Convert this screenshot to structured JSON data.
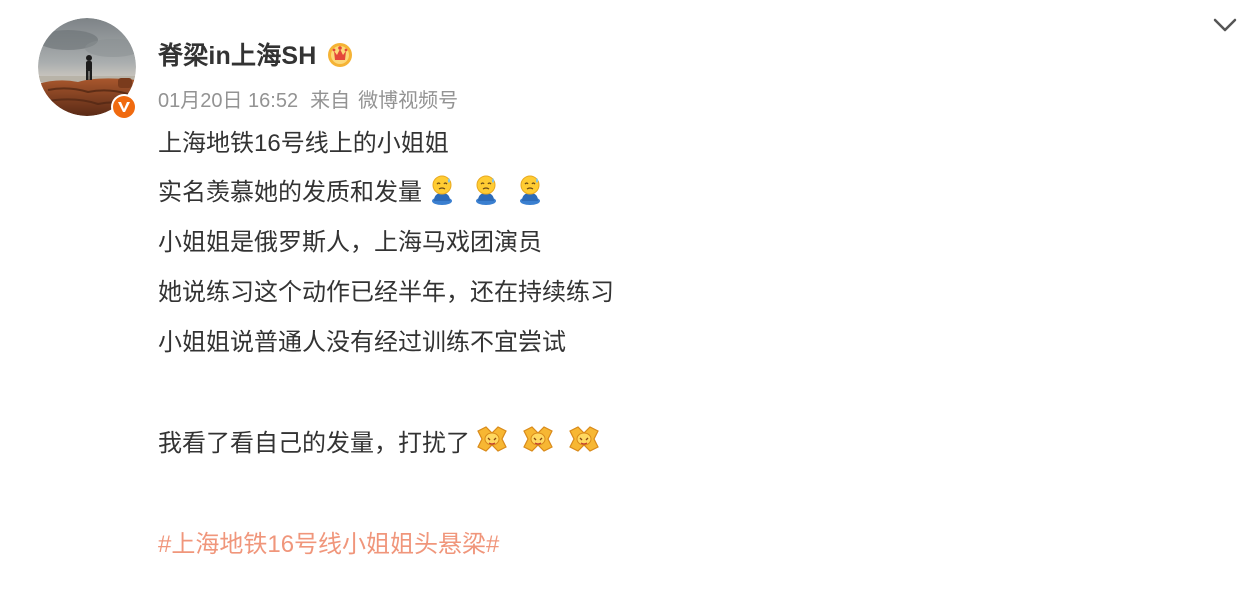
{
  "post": {
    "author": {
      "name": "脊梁in上海SH",
      "avatar_icon": "avatar",
      "verified_icon": "verified-badge-icon",
      "vip_icon": "vip-crown-icon"
    },
    "meta": {
      "time": "01月20日 16:52",
      "from_label": "来自",
      "source": "微博视频号"
    },
    "menu_icon": "chevron-down-icon",
    "lines": [
      "上海地铁16号线上的小姐姐",
      "实名羡慕她的发质和发量",
      "小姐姐是俄罗斯人，上海马戏团演员",
      "她说练习这个动作已经半年，还在持续练习",
      "小姐姐说普通人没有经过训练不宜尝试",
      "我看了看自己的发量，打扰了"
    ],
    "line2_emoji": "sweat-emoji-icon",
    "line6_emoji": "bow-emoji-icon",
    "hashtag": "#上海地铁16号线小姐姐头悬梁#"
  },
  "colors": {
    "text": "#333333",
    "meta": "#939393",
    "hashtag": "#eb7350",
    "verified": "#f06a0f"
  }
}
